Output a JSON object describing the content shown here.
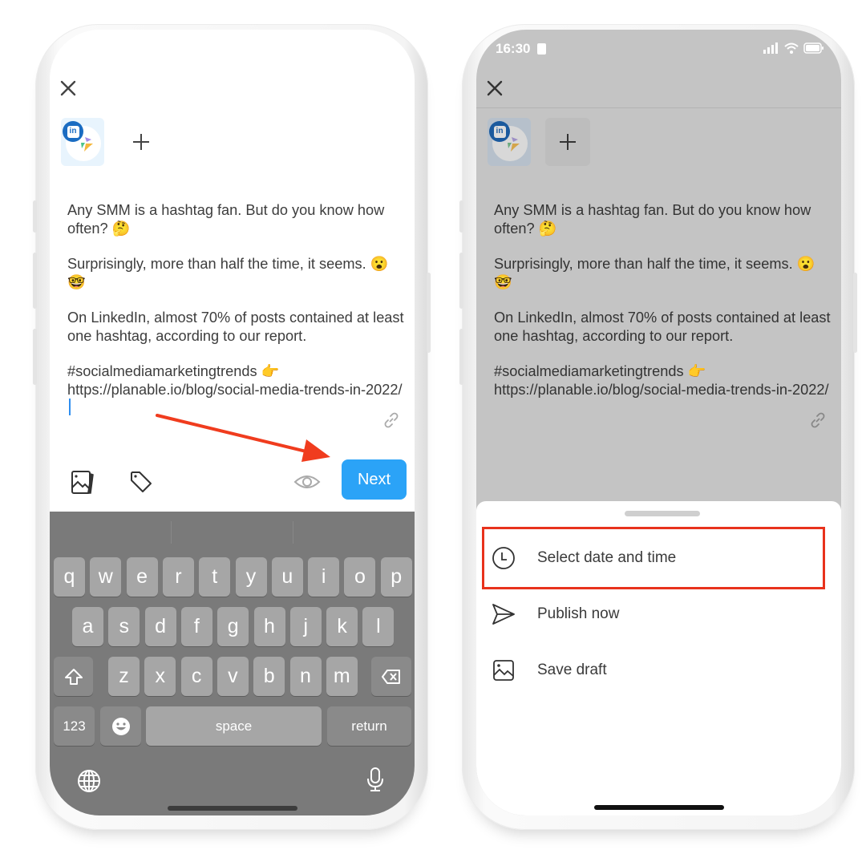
{
  "left_phone": {
    "close_icon": "close-icon",
    "accounts": [
      {
        "network": "LinkedIn",
        "badge": "in"
      }
    ],
    "add_account_icon": "plus-icon",
    "post": {
      "paragraphs": [
        "Any SMM is a hashtag fan. But do you know how often? 🤔",
        "Surprisingly, more than half the time, it seems. 😮 🤓",
        "On LinkedIn, almost 70% of posts contained at least one hashtag, according to our report.",
        "#socialmediamarketingtrends 👉 https://planable.io/blog/social-media-trends-in-2022/"
      ]
    },
    "toolbar": {
      "media_icon": "image-gallery-icon",
      "tag_icon": "tag-icon",
      "preview_icon": "eye-icon",
      "next_label": "Next",
      "next_color": "#2ba3f7"
    },
    "keyboard": {
      "row1": [
        "q",
        "w",
        "e",
        "r",
        "t",
        "y",
        "u",
        "i",
        "o",
        "p"
      ],
      "row2": [
        "a",
        "s",
        "d",
        "f",
        "g",
        "h",
        "j",
        "k",
        "l"
      ],
      "row3": [
        "z",
        "x",
        "c",
        "v",
        "b",
        "n",
        "m"
      ],
      "numbers_label": "123",
      "space_label": "space",
      "return_label": "return"
    },
    "annotation_color": "#f03c1e"
  },
  "right_phone": {
    "status_bar": {
      "time": "16:30"
    },
    "post": {
      "paragraphs": [
        "Any SMM is a hashtag fan. But do you know how often? 🤔",
        "Surprisingly, more than half the time, it seems. 😮 🤓",
        "On LinkedIn, almost 70% of posts contained at least one hashtag, according to our report.",
        "#socialmediamarketingtrends 👉 https://planable.io/blog/social-media-trends-in-2022/"
      ]
    },
    "sheet": {
      "items": [
        {
          "label": "Select date and time",
          "icon": "clock-icon",
          "highlighted": true
        },
        {
          "label": "Publish now",
          "icon": "send-icon",
          "highlighted": false
        },
        {
          "label": "Save draft",
          "icon": "image-icon",
          "highlighted": false
        }
      ],
      "highlight_color": "#e8321c"
    }
  }
}
